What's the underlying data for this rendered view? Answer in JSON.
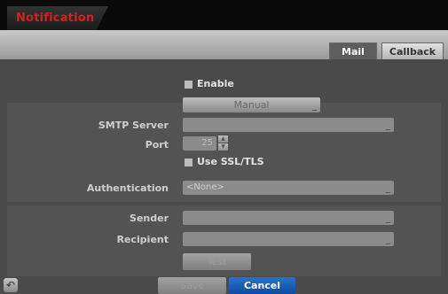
{
  "window": {
    "title": "Notification"
  },
  "tabs": [
    {
      "label": "Mail",
      "active": true
    },
    {
      "label": "Callback",
      "active": false
    }
  ],
  "form": {
    "enable_label": "Enable",
    "mode_value": "Manual",
    "smtp_server_label": "SMTP Server",
    "smtp_server_value": "",
    "port_label": "Port",
    "port_value": "25",
    "ssl_label": "Use SSL/TLS",
    "authentication_label": "Authentication",
    "authentication_value": "<None>",
    "sender_label": "Sender",
    "sender_value": "",
    "recipient_label": "Recipient",
    "recipient_value": "",
    "test_label": "Test"
  },
  "footer": {
    "save_label": "Save",
    "cancel_label": "Cancel",
    "back_icon": "back-arrow-icon"
  },
  "colors": {
    "title_text": "#d42020",
    "primary_button": "#1a5cb3",
    "background": "#4b4b4b"
  }
}
